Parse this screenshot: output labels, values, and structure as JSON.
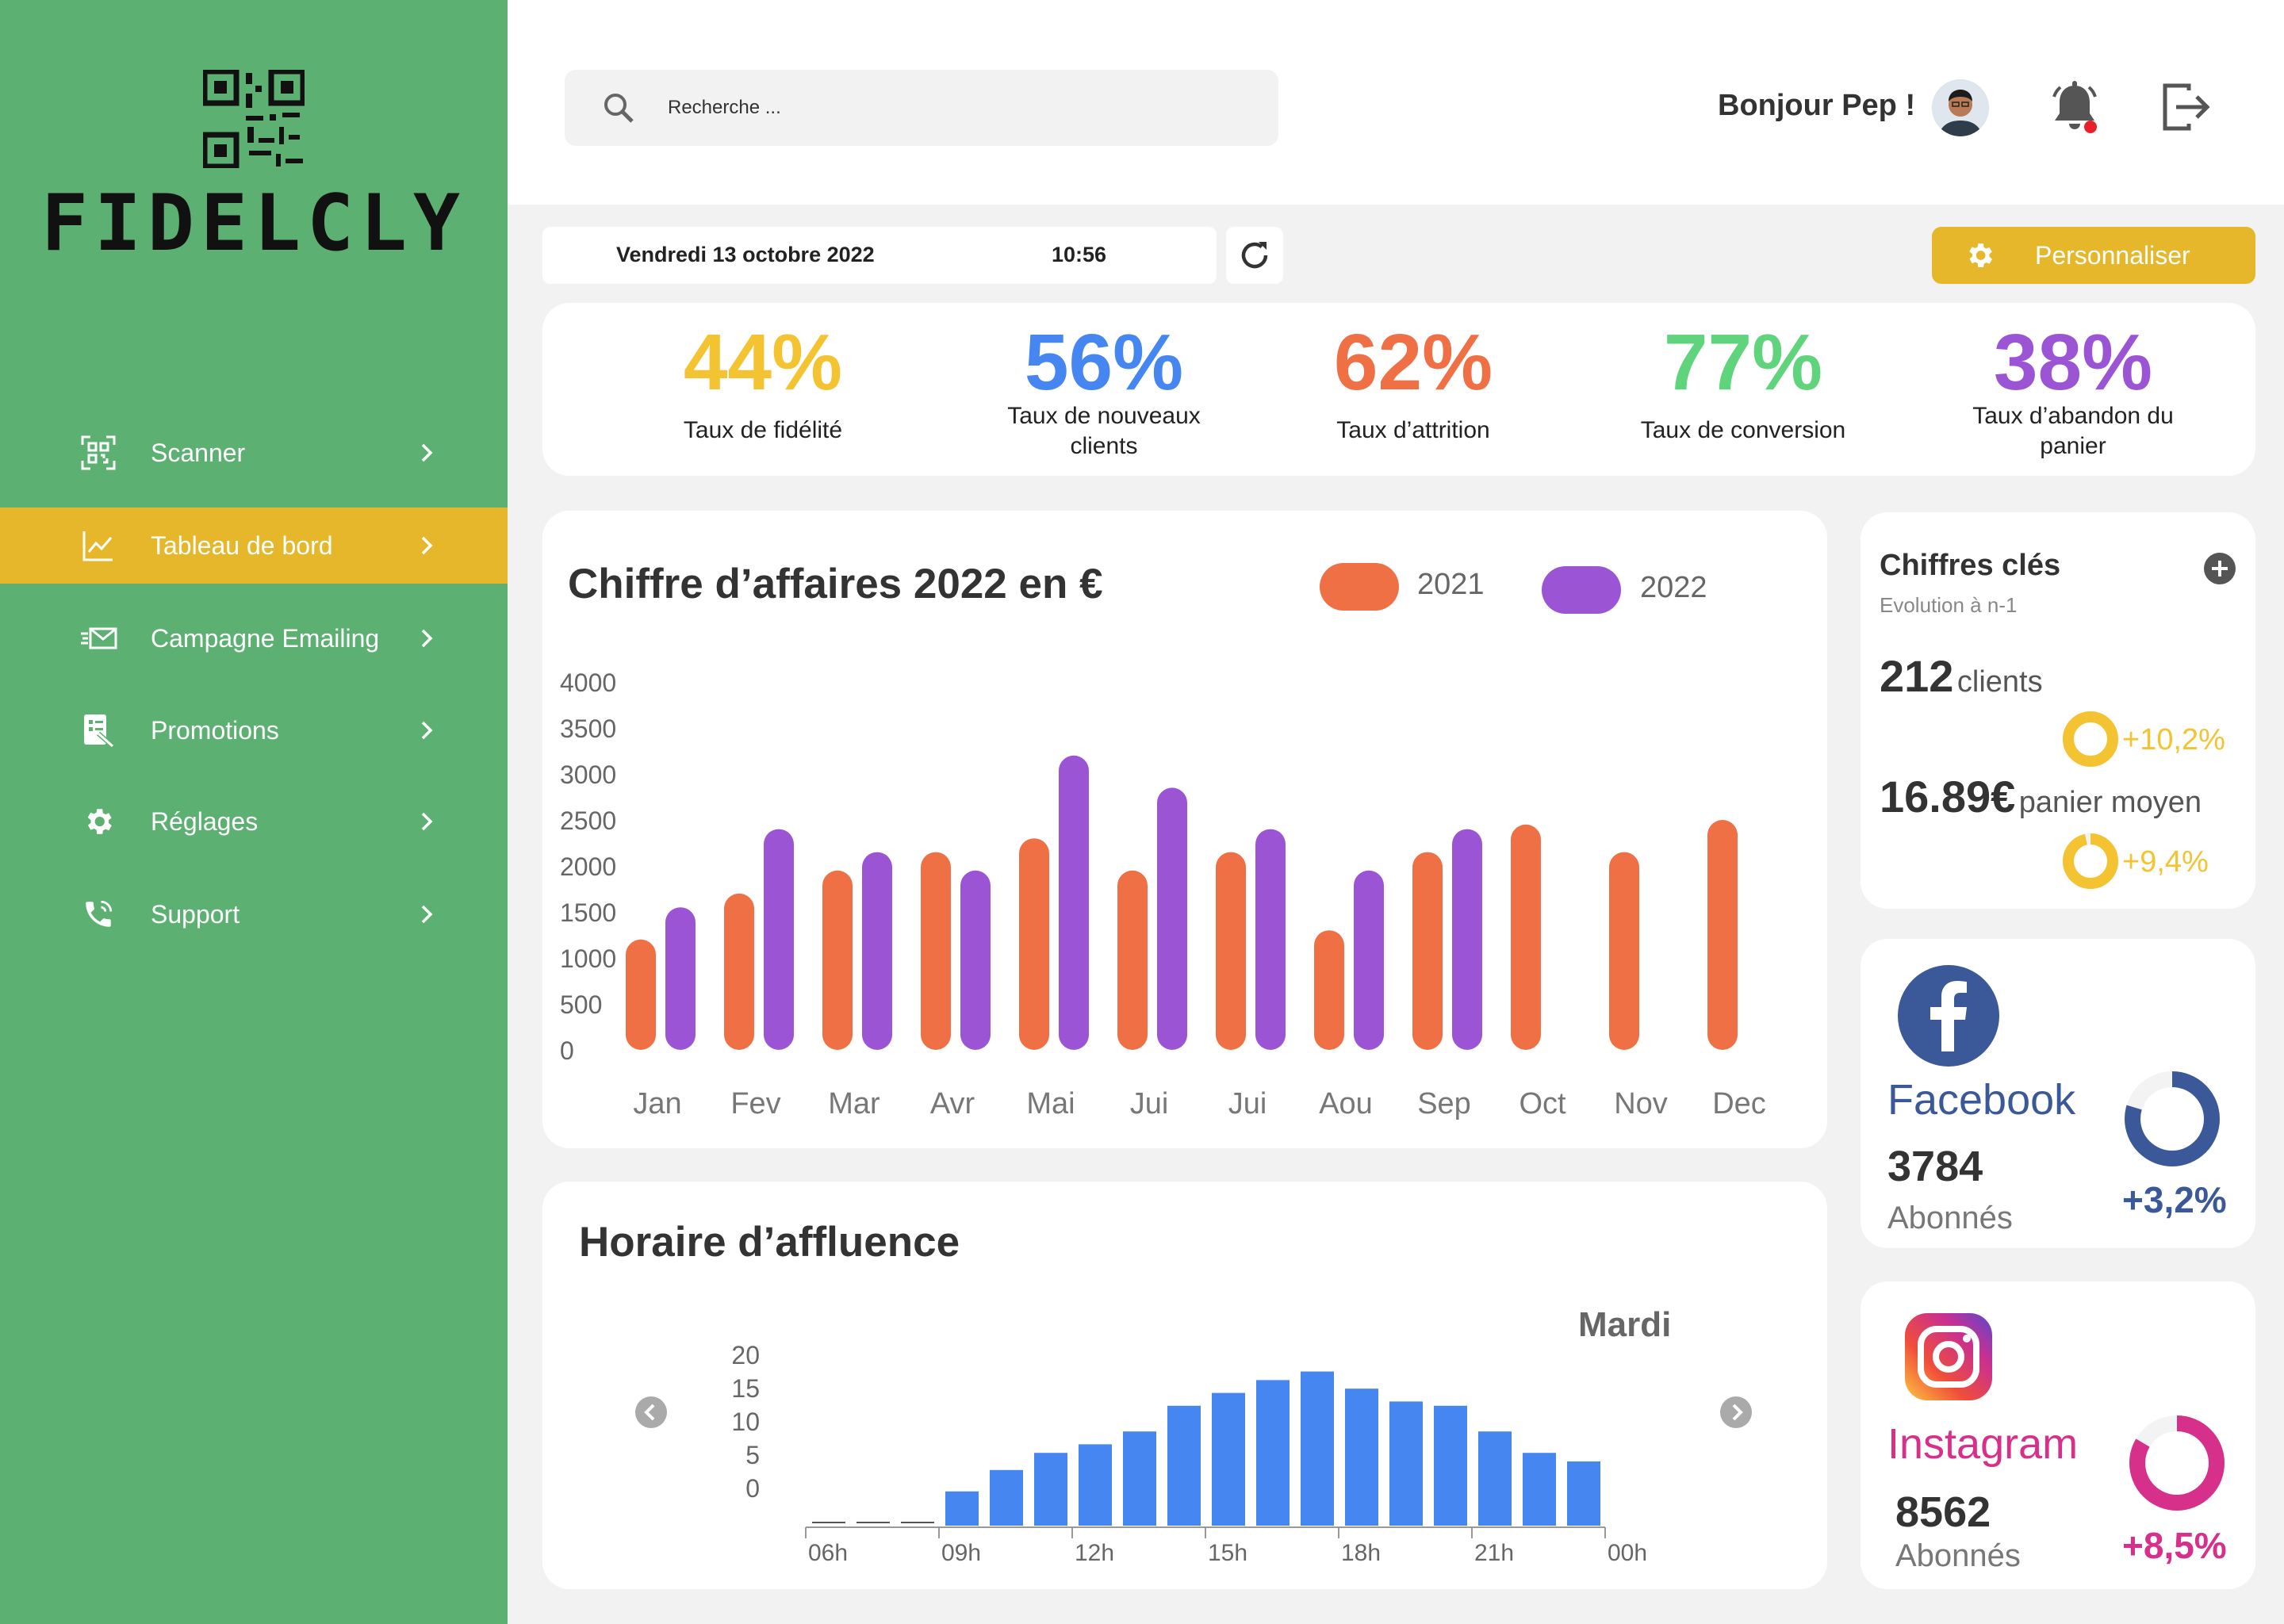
{
  "brand": {
    "name": "FIDELCLY"
  },
  "sidebar": {
    "items": [
      {
        "label": "Scanner",
        "icon": "qr-scan-icon"
      },
      {
        "label": "Tableau de bord",
        "icon": "chart-line-icon",
        "active": true
      },
      {
        "label": "Campagne Emailing",
        "icon": "email-icon"
      },
      {
        "label": "Promotions",
        "icon": "promotions-icon"
      },
      {
        "label": "Réglages",
        "icon": "gear-icon"
      },
      {
        "label": "Support",
        "icon": "phone-icon"
      }
    ]
  },
  "header": {
    "search_placeholder": "Recherche ...",
    "greeting": "Bonjour Pep !"
  },
  "datebar": {
    "date": "Vendredi 13 octobre 2022",
    "time": "10:56",
    "personalize_label": "Personnaliser"
  },
  "colors": {
    "green": "#5cb071",
    "yellow": "#e6b72a",
    "orange": "#f07045",
    "purple": "#9b55d4",
    "blue": "#4586f0",
    "facebook": "#3b5998",
    "instagram": "#d6308a"
  },
  "kpis": [
    {
      "value": "44%",
      "label_lines": [
        "Taux de fidélité"
      ],
      "color": "#f4c332"
    },
    {
      "value": "56%",
      "label_lines": [
        "Taux de nouveaux",
        "clients"
      ],
      "color": "#4586f0"
    },
    {
      "value": "62%",
      "label_lines": [
        "Taux d’attrition"
      ],
      "color": "#f07045"
    },
    {
      "value": "77%",
      "label_lines": [
        "Taux de conversion"
      ],
      "color": "#5fd47c"
    },
    {
      "value": "38%",
      "label_lines": [
        "Taux d’abandon du",
        "panier"
      ],
      "color": "#9b55d4"
    }
  ],
  "revenue": {
    "title": "Chiffre d’affaires 2022 en €",
    "legend": [
      "2021",
      "2022"
    ]
  },
  "traffic": {
    "title": "Horaire d’affluence",
    "day": "Mardi"
  },
  "key_figures": {
    "title": "Chiffres clés",
    "subtitle": "Evolution à n-1",
    "clients_value": "212",
    "clients_unit": "clients",
    "clients_change": "+10,2%",
    "basket_value": "16.89€",
    "basket_unit": "panier moyen",
    "basket_change": "+9,4%"
  },
  "facebook": {
    "name": "Facebook",
    "count": "3784",
    "sub": "Abonnés",
    "change": "+3,2%"
  },
  "instagram": {
    "name": "Instagram",
    "count": "8562",
    "sub": "Abonnés",
    "change": "+8,5%"
  },
  "chart_data": [
    {
      "type": "bar",
      "title": "Chiffre d’affaires 2022 en €",
      "categories": [
        "Jan",
        "Fev",
        "Mar",
        "Avr",
        "Mai",
        "Jui",
        "Jui",
        "Aou",
        "Sep",
        "Oct",
        "Nov",
        "Dec"
      ],
      "series": [
        {
          "name": "2021",
          "color": "#f07045",
          "values": [
            1200,
            1700,
            1950,
            2150,
            2300,
            1950,
            2150,
            1300,
            2150,
            2450,
            2150,
            2500
          ]
        },
        {
          "name": "2022",
          "color": "#9b55d4",
          "values": [
            1550,
            2400,
            2150,
            1950,
            3200,
            2850,
            2400,
            1950,
            2400,
            null,
            null,
            null
          ]
        }
      ],
      "yticks": [
        0,
        500,
        1000,
        1500,
        2000,
        2500,
        3000,
        3500,
        4000
      ],
      "ylim": [
        0,
        4000
      ],
      "legend": "top-right"
    },
    {
      "type": "bar",
      "title": "Horaire d’affluence",
      "subtitle": "Mardi",
      "color": "#4586f0",
      "values": [
        0,
        0,
        0,
        4,
        6.5,
        8.5,
        9.5,
        11,
        14,
        15.5,
        17,
        18,
        16,
        14.5,
        14,
        11,
        8.5,
        7.5
      ],
      "empty_slots": 3,
      "xticks": [
        {
          "label": "06h",
          "slot": 0
        },
        {
          "label": "09h",
          "slot": 3
        },
        {
          "label": "12h",
          "slot": 6
        },
        {
          "label": "15h",
          "slot": 9
        },
        {
          "label": "18h",
          "slot": 12
        },
        {
          "label": "21h",
          "slot": 15
        },
        {
          "label": "00h",
          "slot": 18
        }
      ],
      "yticks": [
        0,
        5,
        10,
        15,
        20
      ],
      "ylim": [
        0,
        20
      ]
    }
  ]
}
